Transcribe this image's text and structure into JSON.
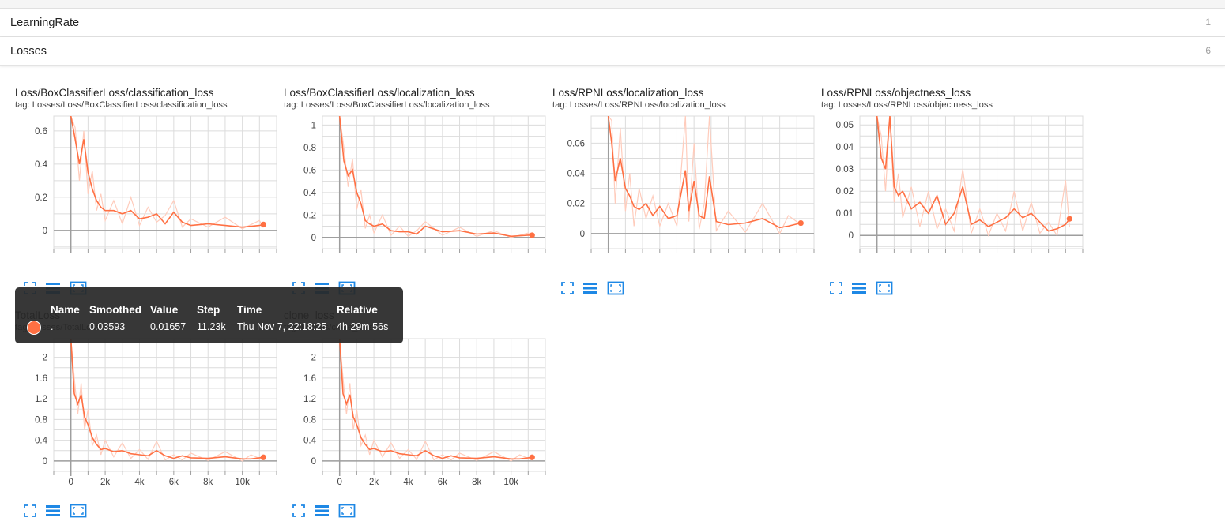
{
  "categories": [
    {
      "name": "LearningRate",
      "count": "1"
    },
    {
      "name": "Losses",
      "count": "6"
    }
  ],
  "colors": {
    "smoothed": "#ff7043",
    "raw": "#ffccbc",
    "grid": "#dcdcdc",
    "axis": "#9e9e9e",
    "button": "#1e88e5"
  },
  "icons": [
    "fullscreen-icon",
    "data-selection-icon",
    "fit-domain-icon"
  ],
  "cards": [
    {
      "title": "Loss/BoxClassifierLoss/classification_loss",
      "tag": "tag: Losses/Loss/BoxClassifierLoss/classification_loss"
    },
    {
      "title": "Loss/BoxClassifierLoss/localization_loss",
      "tag": "tag: Losses/Loss/BoxClassifierLoss/localization_loss"
    },
    {
      "title": "Loss/RPNLoss/localization_loss",
      "tag": "tag: Losses/Loss/RPNLoss/localization_loss"
    },
    {
      "title": "Loss/RPNLoss/objectness_loss",
      "tag": "tag: Losses/Loss/RPNLoss/objectness_loss"
    },
    {
      "title": "TotalLoss",
      "tag": "tag: Losses/TotalLoss"
    },
    {
      "title": "clone_loss",
      "tag": "tag: Losses/clone_loss"
    }
  ],
  "tooltip": {
    "headers": {
      "name": "Name",
      "smoothed": "Smoothed",
      "value": "Value",
      "step": "Step",
      "time": "Time",
      "relative": "Relative"
    },
    "row": {
      "name": ".",
      "smoothed": "0.03593",
      "value": "0.01657",
      "step": "11.23k",
      "time": "Thu Nov 7, 22:18:25",
      "relative": "4h 29m 56s"
    }
  },
  "chart_data": [
    {
      "type": "line",
      "title": "Loss/BoxClassifierLoss/classification_loss",
      "x_ticks": [
        0,
        2000,
        4000,
        6000,
        8000,
        10000
      ],
      "y_ticks": [
        0,
        0.2,
        0.4,
        0.6
      ],
      "y_tick_labels": [
        "0",
        "0.2",
        "0.4",
        "0.6"
      ],
      "x_range": [
        -1000,
        12000
      ],
      "y_range": [
        -0.11,
        0.69
      ],
      "show_x_labels": false,
      "last_point": {
        "x": 11230,
        "y": 0.036
      },
      "series": [
        {
          "x": [
            0,
            250,
            500,
            750,
            1000,
            1250,
            1500,
            1750,
            2000,
            2500,
            3000,
            3500,
            4000,
            4500,
            5000,
            5500,
            6000,
            6500,
            7000,
            8000,
            9000,
            10000,
            11000,
            11230
          ],
          "smoothed": [
            0.69,
            0.55,
            0.4,
            0.55,
            0.35,
            0.25,
            0.18,
            0.14,
            0.12,
            0.12,
            0.1,
            0.12,
            0.07,
            0.08,
            0.1,
            0.04,
            0.11,
            0.05,
            0.03,
            0.04,
            0.03,
            0.02,
            0.03,
            0.036
          ],
          "raw": [
            0.69,
            0.62,
            0.3,
            0.6,
            0.22,
            0.36,
            0.12,
            0.22,
            0.06,
            0.18,
            0.04,
            0.2,
            0.03,
            0.14,
            0.05,
            0.09,
            0.18,
            0.02,
            0.07,
            0.02,
            0.08,
            0.01,
            0.06,
            0.017
          ]
        }
      ]
    },
    {
      "type": "line",
      "title": "Loss/BoxClassifierLoss/localization_loss",
      "x_ticks": [
        0,
        2000,
        4000,
        6000,
        8000,
        10000
      ],
      "y_ticks": [
        0,
        0.2,
        0.4,
        0.6,
        0.8,
        1
      ],
      "y_tick_labels": [
        "0",
        "0.2",
        "0.4",
        "0.6",
        "0.8",
        "1"
      ],
      "x_range": [
        -1000,
        12000
      ],
      "y_range": [
        -0.1,
        1.08
      ],
      "show_x_labels": false,
      "last_point": {
        "x": 11230,
        "y": 0.02
      },
      "series": [
        {
          "x": [
            0,
            250,
            500,
            750,
            1000,
            1250,
            1500,
            1750,
            2000,
            2500,
            3000,
            3500,
            4000,
            4500,
            5000,
            6000,
            7000,
            8000,
            9000,
            10000,
            11000,
            11230
          ],
          "smoothed": [
            1.08,
            0.68,
            0.55,
            0.6,
            0.4,
            0.3,
            0.15,
            0.12,
            0.1,
            0.12,
            0.06,
            0.05,
            0.05,
            0.03,
            0.1,
            0.05,
            0.06,
            0.03,
            0.04,
            0.01,
            0.02,
            0.02
          ],
          "raw": [
            1.08,
            0.8,
            0.45,
            0.7,
            0.25,
            0.42,
            0.08,
            0.2,
            0.04,
            0.2,
            0.02,
            0.1,
            0.01,
            0.06,
            0.14,
            0.02,
            0.09,
            0.01,
            0.06,
            0.0,
            0.04,
            0.016
          ]
        }
      ]
    },
    {
      "type": "line",
      "title": "Loss/RPNLoss/localization_loss",
      "x_ticks": [
        0,
        2000,
        4000,
        6000,
        8000,
        10000
      ],
      "y_ticks": [
        0,
        0.02,
        0.04,
        0.06
      ],
      "y_tick_labels": [
        "0",
        "0.02",
        "0.04",
        "0.06"
      ],
      "x_range": [
        -1000,
        12000
      ],
      "y_range": [
        -0.01,
        0.078
      ],
      "show_x_labels": false,
      "last_point": {
        "x": 11230,
        "y": 0.007
      },
      "series": [
        {
          "x": [
            0,
            200,
            400,
            700,
            1000,
            1250,
            1500,
            1800,
            2200,
            2600,
            3000,
            3500,
            4000,
            4500,
            4700,
            5000,
            5300,
            5600,
            5900,
            6300,
            7000,
            8000,
            9000,
            10000,
            10500,
            11230
          ],
          "smoothed": [
            0.078,
            0.06,
            0.035,
            0.05,
            0.03,
            0.025,
            0.018,
            0.016,
            0.02,
            0.012,
            0.018,
            0.01,
            0.012,
            0.042,
            0.015,
            0.035,
            0.012,
            0.01,
            0.038,
            0.008,
            0.006,
            0.007,
            0.01,
            0.004,
            0.005,
            0.007
          ],
          "raw": [
            0.078,
            0.075,
            0.02,
            0.07,
            0.015,
            0.04,
            0.005,
            0.03,
            0.01,
            0.025,
            0.005,
            0.02,
            0.005,
            0.078,
            0.008,
            0.06,
            0.003,
            0.02,
            0.078,
            0.002,
            0.015,
            0.001,
            0.02,
            0.0,
            0.012,
            0.006
          ]
        }
      ]
    },
    {
      "type": "line",
      "title": "Loss/RPNLoss/objectness_loss",
      "x_ticks": [
        0,
        2000,
        4000,
        6000,
        8000,
        10000
      ],
      "y_ticks": [
        0,
        0.01,
        0.02,
        0.03,
        0.04,
        0.05
      ],
      "y_tick_labels": [
        "0",
        "0.01",
        "0.02",
        "0.03",
        "0.04",
        "0.05"
      ],
      "x_range": [
        -1000,
        12000
      ],
      "y_range": [
        -0.006,
        0.054
      ],
      "show_x_labels": false,
      "last_point": {
        "x": 11230,
        "y": 0.0075
      },
      "series": [
        {
          "x": [
            0,
            250,
            500,
            750,
            1000,
            1250,
            1500,
            2000,
            2500,
            3000,
            3500,
            4000,
            4500,
            5000,
            5500,
            6000,
            6500,
            7000,
            7500,
            8000,
            8500,
            9000,
            9500,
            10000,
            10500,
            11000,
            11230
          ],
          "smoothed": [
            0.054,
            0.035,
            0.03,
            0.054,
            0.022,
            0.018,
            0.02,
            0.012,
            0.015,
            0.01,
            0.018,
            0.005,
            0.01,
            0.022,
            0.005,
            0.007,
            0.004,
            0.006,
            0.008,
            0.012,
            0.008,
            0.01,
            0.006,
            0.002,
            0.003,
            0.005,
            0.0075
          ],
          "raw": [
            0.054,
            0.045,
            0.02,
            0.054,
            0.015,
            0.028,
            0.008,
            0.022,
            0.004,
            0.02,
            0.003,
            0.012,
            0.002,
            0.03,
            0.001,
            0.012,
            0.0,
            0.01,
            0.002,
            0.02,
            0.002,
            0.015,
            0.001,
            0.006,
            0.0,
            0.025,
            0.004
          ]
        }
      ]
    },
    {
      "type": "line",
      "title": "TotalLoss",
      "x_ticks": [
        0,
        2000,
        4000,
        6000,
        8000,
        10000
      ],
      "x_tick_labels": [
        "0",
        "2k",
        "4k",
        "6k",
        "8k",
        "10k"
      ],
      "y_ticks": [
        0,
        0.4,
        0.8,
        1.2,
        1.6,
        2
      ],
      "y_tick_labels": [
        "0",
        "0.4",
        "0.8",
        "1.2",
        "1.6",
        "2"
      ],
      "x_range": [
        -1000,
        12000
      ],
      "y_range": [
        -0.2,
        2.36
      ],
      "show_x_labels": true,
      "last_point": {
        "x": 11230,
        "y": 0.07
      },
      "series": [
        {
          "x": [
            0,
            200,
            400,
            600,
            800,
            1000,
            1250,
            1500,
            1750,
            2000,
            2500,
            3000,
            3500,
            4000,
            4500,
            5000,
            5500,
            6000,
            6500,
            7000,
            8000,
            9000,
            10000,
            10500,
            11230
          ],
          "smoothed": [
            2.36,
            1.3,
            1.1,
            1.28,
            0.85,
            0.7,
            0.45,
            0.32,
            0.22,
            0.24,
            0.18,
            0.2,
            0.14,
            0.12,
            0.1,
            0.2,
            0.1,
            0.05,
            0.1,
            0.06,
            0.05,
            0.08,
            0.04,
            0.04,
            0.07
          ],
          "raw": [
            2.36,
            1.6,
            0.9,
            1.5,
            0.6,
            1.0,
            0.3,
            0.5,
            0.12,
            0.4,
            0.08,
            0.35,
            0.05,
            0.22,
            0.03,
            0.38,
            0.02,
            0.12,
            0.02,
            0.15,
            0.01,
            0.18,
            0.0,
            0.12,
            0.017
          ]
        }
      ]
    },
    {
      "type": "line",
      "title": "clone_loss",
      "x_ticks": [
        0,
        2000,
        4000,
        6000,
        8000,
        10000
      ],
      "x_tick_labels": [
        "0",
        "2k",
        "4k",
        "6k",
        "8k",
        "10k"
      ],
      "y_ticks": [
        0,
        0.4,
        0.8,
        1.2,
        1.6,
        2
      ],
      "y_tick_labels": [
        "0",
        "0.4",
        "0.8",
        "1.2",
        "1.6",
        "2"
      ],
      "x_range": [
        -1000,
        12000
      ],
      "y_range": [
        -0.2,
        2.36
      ],
      "show_x_labels": true,
      "last_point": {
        "x": 11230,
        "y": 0.07
      },
      "series": [
        {
          "x": [
            0,
            200,
            400,
            600,
            800,
            1000,
            1250,
            1500,
            1750,
            2000,
            2500,
            3000,
            3500,
            4000,
            4500,
            5000,
            5500,
            6000,
            6500,
            7000,
            8000,
            9000,
            10000,
            10500,
            11230
          ],
          "smoothed": [
            2.36,
            1.3,
            1.1,
            1.28,
            0.85,
            0.7,
            0.45,
            0.32,
            0.22,
            0.24,
            0.18,
            0.2,
            0.14,
            0.12,
            0.1,
            0.2,
            0.1,
            0.05,
            0.1,
            0.06,
            0.05,
            0.08,
            0.04,
            0.04,
            0.07
          ],
          "raw": [
            2.36,
            1.6,
            0.9,
            1.5,
            0.6,
            1.0,
            0.3,
            0.5,
            0.12,
            0.4,
            0.08,
            0.35,
            0.05,
            0.22,
            0.03,
            0.38,
            0.02,
            0.12,
            0.02,
            0.15,
            0.01,
            0.18,
            0.0,
            0.12,
            0.017
          ]
        }
      ]
    }
  ]
}
